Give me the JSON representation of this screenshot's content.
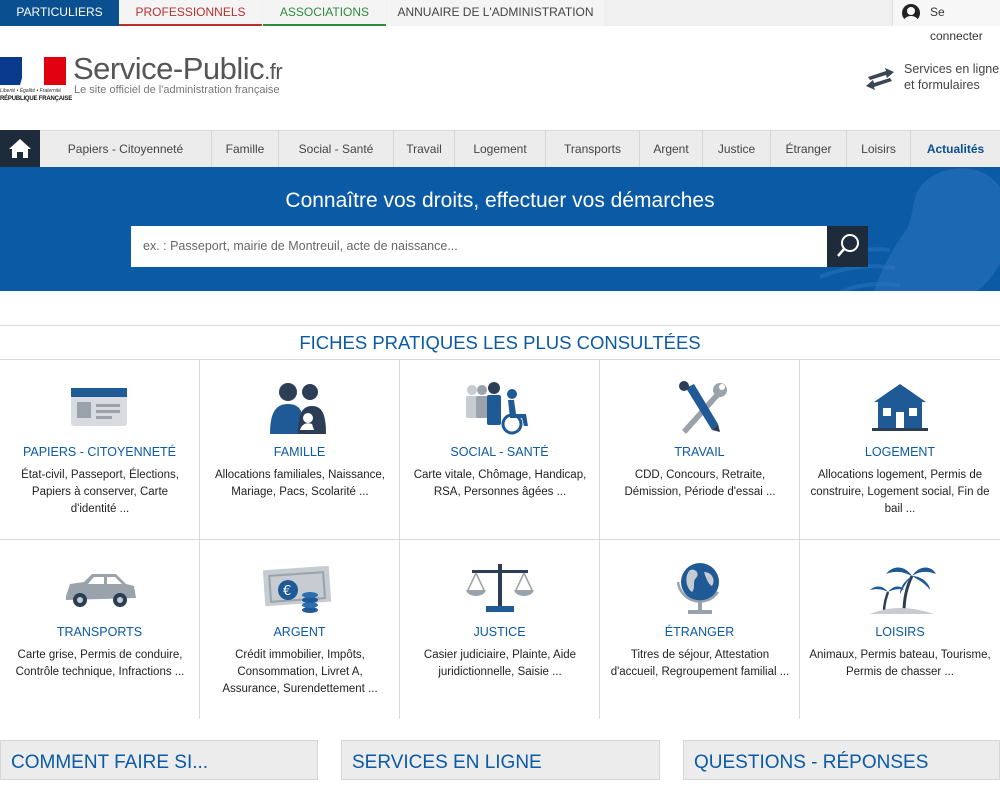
{
  "topbar": {
    "tabs": [
      "Particuliers",
      "Professionnels",
      "Associations",
      "Annuaire de l'administration"
    ],
    "connect_label": "Se connecter"
  },
  "header": {
    "logo": {
      "motto": "Liberté • Égalité • Fraternité",
      "republic": "RÉPUBLIQUE FRANÇAISE"
    },
    "brand": "Service-Public",
    "brand_suffix": ".fr",
    "tagline": "Le site officiel de l'administration française",
    "services_line1": "Services en ligne",
    "services_line2": "et formulaires"
  },
  "nav": {
    "items": [
      "Papiers - Citoyenneté",
      "Famille",
      "Social - Santé",
      "Travail",
      "Logement",
      "Transports",
      "Argent",
      "Justice",
      "Étranger",
      "Loisirs",
      "Actualités"
    ]
  },
  "hero": {
    "title": "Connaître vos droits, effectuer vos démarches",
    "search_placeholder": "ex. : Passeport, mairie de Montreuil, acte de naissance..."
  },
  "fiches": {
    "title": "FICHES PRATIQUES LES PLUS CONSULTÉES",
    "cards": [
      {
        "title": "Papiers - Citoyenneté",
        "desc": "État-civil, Passeport, Élections, Papiers à conserver, Carte d'identité ...",
        "icon": "id-card-icon"
      },
      {
        "title": "Famille",
        "desc": "Allocations familiales, Naissance, Mariage, Pacs, Scolarité ...",
        "icon": "family-icon"
      },
      {
        "title": "Social - Santé",
        "desc": "Carte vitale, Chômage, Handicap, RSA, Personnes âgées ...",
        "icon": "social-icon"
      },
      {
        "title": "Travail",
        "desc": "CDD, Concours, Retraite, Démission, Période d'essai ...",
        "icon": "tools-icon"
      },
      {
        "title": "Logement",
        "desc": "Allocations logement, Permis de construire, Logement social, Fin de bail ...",
        "icon": "house-icon"
      },
      {
        "title": "Transports",
        "desc": "Carte grise, Permis de conduire, Contrôle technique, Infractions ...",
        "icon": "car-icon"
      },
      {
        "title": "Argent",
        "desc": "Crédit immobilier, Impôts, Consommation, Livret A, Assurance, Surendettement ...",
        "icon": "money-icon"
      },
      {
        "title": "Justice",
        "desc": "Casier judiciaire, Plainte, Aide juridictionnelle, Saisie ...",
        "icon": "scales-icon"
      },
      {
        "title": "Étranger",
        "desc": "Titres de séjour, Attestation d'accueil, Regroupement familial ...",
        "icon": "globe-icon"
      },
      {
        "title": "Loisirs",
        "desc": "Animaux, Permis bateau, Tourisme, Permis de chasser ...",
        "icon": "palm-icon"
      }
    ]
  },
  "panels": [
    "Comment faire si...",
    "Services en ligne",
    "Questions - Réponses"
  ],
  "colors": {
    "primary": "#0a5aa6",
    "dark": "#1d2b3a",
    "pro_red": "#b8312f",
    "asso_green": "#2e8b3a"
  }
}
